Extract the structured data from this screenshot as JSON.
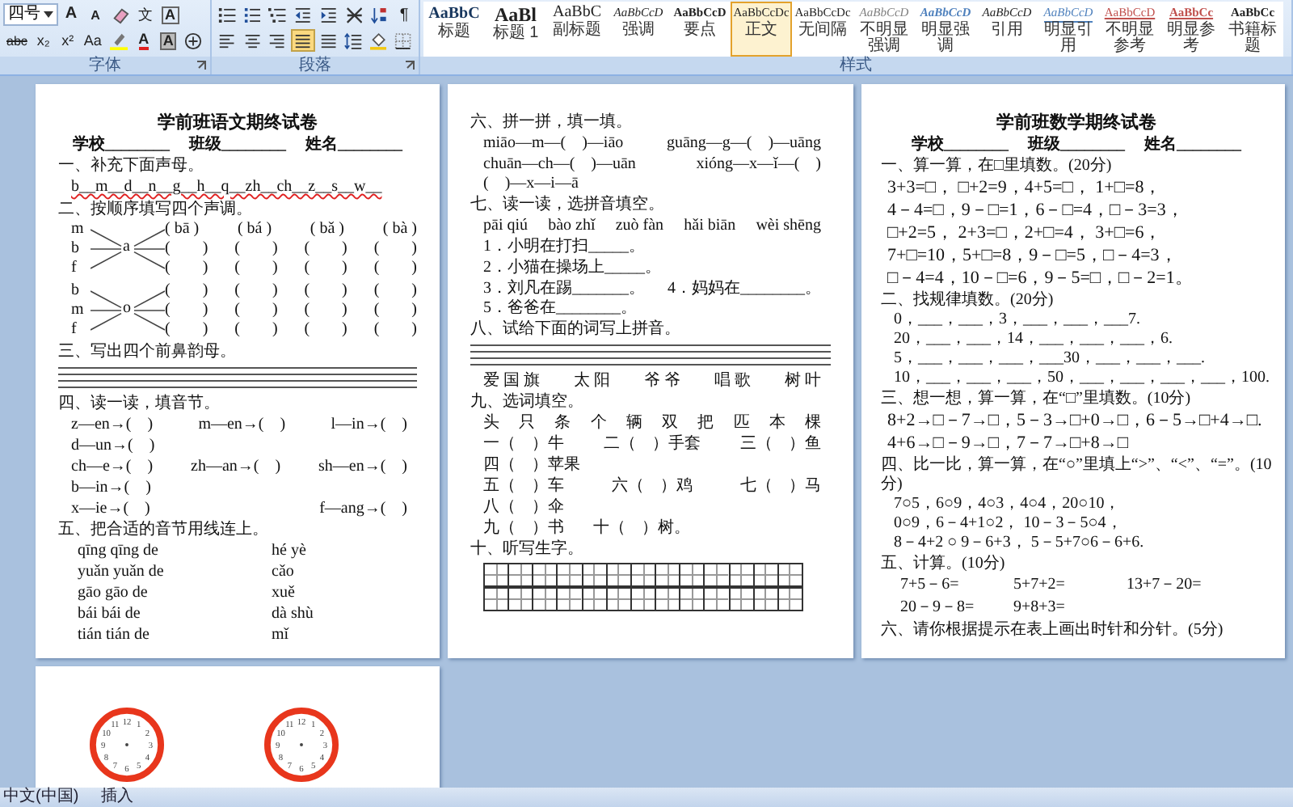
{
  "ribbon": {
    "font_group": {
      "label": "字体",
      "size_field": "四号",
      "row1": [
        {
          "kind": "grow",
          "label": "A"
        },
        {
          "kind": "shrink",
          "label": "A"
        },
        {
          "kind": "clear"
        },
        {
          "kind": "phonetic",
          "label": "文"
        },
        {
          "kind": "boxed",
          "label": "A"
        }
      ],
      "row2": [
        {
          "kind": "strike",
          "label": "abc"
        },
        {
          "kind": "sub",
          "label": "x₂"
        },
        {
          "kind": "sup",
          "label": "x²"
        },
        {
          "kind": "case",
          "label": "Aa"
        },
        {
          "kind": "highlight"
        },
        {
          "kind": "color",
          "label": "A"
        },
        {
          "kind": "shade",
          "label": "A"
        },
        {
          "kind": "enclose"
        }
      ]
    },
    "para_group": {
      "label": "段落",
      "row1": [
        {
          "kind": "bullets"
        },
        {
          "kind": "numbering"
        },
        {
          "kind": "multilevel"
        },
        {
          "kind": "outdent"
        },
        {
          "kind": "indent"
        },
        {
          "kind": "asian_layout"
        },
        {
          "kind": "sort"
        },
        {
          "kind": "pilcrow",
          "label": "¶"
        }
      ],
      "row2": [
        {
          "kind": "align_left",
          "selected": false
        },
        {
          "kind": "align_center",
          "selected": false
        },
        {
          "kind": "align_right",
          "selected": false
        },
        {
          "kind": "justify",
          "selected": true
        },
        {
          "kind": "distributed",
          "selected": false
        },
        {
          "kind": "line_spacing",
          "selected": false
        },
        {
          "kind": "shading",
          "selected": false
        },
        {
          "kind": "borders",
          "selected": false
        }
      ]
    },
    "styles_group": {
      "label": "样式",
      "styles": [
        {
          "kind": "heading",
          "sample": "AaBbC",
          "name": "标题",
          "selected": false
        },
        {
          "kind": "title",
          "sample": "AaBl",
          "name": "标题 1",
          "selected": false
        },
        {
          "kind": "subtitle",
          "sample": "AaBbC",
          "name": "副标题",
          "selected": false
        },
        {
          "kind": "emphasis",
          "sample": "AaBbCcD",
          "name": "强调",
          "selected": false
        },
        {
          "kind": "strong",
          "sample": "AaBbCcD",
          "name": "要点",
          "selected": false
        },
        {
          "kind": "normal",
          "sample": "AaBbCcDc",
          "name": "正文",
          "selected": true
        },
        {
          "kind": "nospacing",
          "sample": "AaBbCcDc",
          "name": "无间隔",
          "selected": false
        },
        {
          "kind": "subtle_emphasis",
          "sample": "AaBbCcD",
          "name": "不明显强调",
          "selected": false
        },
        {
          "kind": "intense_emphasis",
          "sample": "AaBbCcD",
          "name": "明显强调",
          "selected": false
        },
        {
          "kind": "quote",
          "sample": "AaBbCcD",
          "name": "引用",
          "selected": false
        },
        {
          "kind": "intense_quote",
          "sample": "AaBbCcD",
          "name": "明显引用",
          "selected": false
        },
        {
          "kind": "subtle_reference",
          "sample": "AaBbCcD",
          "name": "不明显参考",
          "selected": false
        },
        {
          "kind": "intense_reference",
          "sample": "AaBbCc",
          "name": "明显参考",
          "selected": false
        },
        {
          "kind": "book_title",
          "sample": "AaBbCc",
          "name": "书籍标题",
          "selected": false
        }
      ]
    }
  },
  "pages": [
    {
      "blocks": [
        {
          "kind": "title",
          "text": "学前班语文期终试卷"
        },
        {
          "kind": "fields",
          "items": [
            "学校________",
            "班级________",
            "姓名________"
          ]
        },
        {
          "kind": "heading",
          "text": "一、补充下面声母。"
        },
        {
          "kind": "spelling",
          "text": "b__m__d__n__g__h__q__zh__ch__z__s__w__"
        },
        {
          "kind": "heading",
          "text": "二、按顺序填写四个声调。"
        },
        {
          "kind": "fan",
          "letters": [
            "m",
            "b",
            "f"
          ],
          "vowel": "a",
          "rows": [
            [
              "( bā )",
              "( bá )",
              "( bǎ )",
              "( bà )"
            ],
            [
              "(　　)",
              "(　　)",
              "(　　)",
              "(　　)"
            ],
            [
              "(　　)",
              "(　　)",
              "(　　)",
              "(　　)"
            ]
          ]
        },
        {
          "kind": "fan",
          "letters": [
            "b",
            "m",
            "f"
          ],
          "vowel": "o",
          "rows": [
            [
              "(　　)",
              "(　　)",
              "(　　)",
              "(　　)"
            ],
            [
              "(　　)",
              "(　　)",
              "(　　)",
              "(　　)"
            ],
            [
              "(　　)",
              "(　　)",
              "(　　)",
              "(　　)"
            ]
          ]
        },
        {
          "kind": "heading",
          "text": "三、写出四个前鼻韵母。"
        },
        {
          "kind": "rules"
        },
        {
          "kind": "heading",
          "text": "四、读一读，填音节。"
        },
        {
          "kind": "cols",
          "cells": [
            "z—en→(　)",
            "m—en→(　)",
            "l—in→(　)",
            "d—un→(　)"
          ]
        },
        {
          "kind": "cols",
          "cells": [
            "ch—e→(　)",
            "zh—an→(　)",
            "sh—en→(　)",
            "b—in→(　)"
          ]
        },
        {
          "kind": "cols",
          "cells": [
            "x—ie→(　)",
            "f—ang→(　)"
          ]
        },
        {
          "kind": "heading",
          "text": "五、把合适的音节用线连上。"
        },
        {
          "kind": "pair",
          "cells": [
            "qīng qīng de",
            "hé yè"
          ]
        },
        {
          "kind": "pair",
          "cells": [
            "yuǎn yuǎn de",
            "cǎo"
          ]
        },
        {
          "kind": "pair",
          "cells": [
            "gāo gāo de",
            "xuě"
          ]
        },
        {
          "kind": "pair",
          "cells": [
            "bái bái de",
            "dà shù"
          ]
        },
        {
          "kind": "pair",
          "cells": [
            "tián tián de",
            "mǐ"
          ]
        }
      ]
    },
    {
      "blocks": [
        {
          "kind": "heading",
          "text": "六、拼一拼，填一填。"
        },
        {
          "kind": "cols",
          "cells": [
            "miāo—m—(　)—iāo",
            "guāng—g—(　)—uāng"
          ]
        },
        {
          "kind": "cols",
          "cells": [
            "chuān—ch—(　)—uān",
            "xióng—x—ǐ—(　)"
          ]
        },
        {
          "kind": "line",
          "text": "(　)—x—i—ā"
        },
        {
          "kind": "heading",
          "text": "七、读一读，选拼音填空。"
        },
        {
          "kind": "cols",
          "cells": [
            "pāi qiú",
            "bào zhǐ",
            "zuò fàn",
            "hǎi biān",
            "wèi shēng"
          ]
        },
        {
          "kind": "cols",
          "cells": [
            "1．小明在打扫_____。",
            "2．小猫在操场上_____。"
          ]
        },
        {
          "kind": "cols",
          "cells": [
            "3．刘凡在踢_______。",
            "4．妈妈在________。"
          ]
        },
        {
          "kind": "line",
          "text": "5．爸爸在________。"
        },
        {
          "kind": "heading",
          "text": "八、试给下面的词写上拼音。"
        },
        {
          "kind": "rules"
        },
        {
          "kind": "cols",
          "cells": [
            "爱 国 旗",
            "太 阳",
            "爷 爷",
            "唱 歌",
            "树 叶"
          ]
        },
        {
          "kind": "heading",
          "text": "九、选词填空。"
        },
        {
          "kind": "cols",
          "cells": [
            "头",
            "只",
            "条",
            "个",
            "辆",
            "双",
            "把",
            "匹",
            "本",
            "棵"
          ]
        },
        {
          "kind": "cols",
          "cells": [
            "一（　）牛",
            "二（　）手套",
            "三（　）鱼",
            "四（　）苹果"
          ]
        },
        {
          "kind": "cols",
          "cells": [
            "五（　）车",
            "六（　）鸡",
            "七（　）马",
            "八（　）伞"
          ]
        },
        {
          "kind": "inline",
          "cells": [
            "九（　）书",
            "十（　）树。"
          ]
        },
        {
          "kind": "heading",
          "text": "十、听写生字。"
        },
        {
          "kind": "grid"
        }
      ]
    },
    {
      "blocks": [
        {
          "kind": "title",
          "text": "学前班数学期终试卷"
        },
        {
          "kind": "fields",
          "items": [
            "学校________",
            "班级________",
            "姓名________"
          ]
        },
        {
          "kind": "heading",
          "text": "一、算一算，在□里填数。(20分)"
        },
        {
          "kind": "eq",
          "text": "3+3=□，  □+2=9，4+5=□，  1+□=8，"
        },
        {
          "kind": "eq",
          "text": "4－4=□，9－□=1，6－□=4，□－3=3，"
        },
        {
          "kind": "eq",
          "text": "□+2=5，  2+3=□，2+□=4，  3+□=6，"
        },
        {
          "kind": "eq",
          "text": "7+□=10，5+□=8，9－□=5，□－4=3，"
        },
        {
          "kind": "eq",
          "text": "□－4=4，10－□=6，9－5=□，□－2=1。"
        },
        {
          "kind": "heading",
          "text": "二、找规律填数。(20分)"
        },
        {
          "kind": "line",
          "text": "0，___，___，3，___，___，___7."
        },
        {
          "kind": "line",
          "text": "20，___，___，14，___，___，___，6."
        },
        {
          "kind": "line",
          "text": "5，___，___，___，___30，___，___，___."
        },
        {
          "kind": "line",
          "text": "10，___，___，___，50，___，___，___，___，100."
        },
        {
          "kind": "heading",
          "text": "三、想一想，算一算，在“□”里填数。(10分)"
        },
        {
          "kind": "eq",
          "text": "8+2→□－7→□，5－3→□+0→□，6－5→□+4→□."
        },
        {
          "kind": "eq",
          "text": "4+6→□－9→□，7－7→□+8→□"
        },
        {
          "kind": "heading",
          "text": "四、比一比，算一算，在“○”里填上“>”、“<”、“=”。(10分)"
        },
        {
          "kind": "line",
          "text": "7○5，6○9，4○3，4○4，20○10，"
        },
        {
          "kind": "line",
          "text": "0○9，6－4+1○2，  10－3－5○4，"
        },
        {
          "kind": "line",
          "text": "8－4+2 ○ 9－6+3，   5－5+7○6－6+6."
        },
        {
          "kind": "heading",
          "text": "五、计算。(10分)"
        },
        {
          "kind": "cols3",
          "cells": [
            "7+5－6=",
            "5+7+2=",
            "13+7－20="
          ]
        },
        {
          "kind": "cols3",
          "cells": [
            "20－9－8=",
            "9+8+3="
          ]
        },
        {
          "kind": "heading",
          "text": "六、请你根据提示在表上画出时针和分针。(5分)"
        }
      ]
    }
  ],
  "last_page": {
    "clocks": [
      {
        "numbers": [
          "11",
          "12",
          "1",
          "10",
          "2",
          "9",
          "3",
          "8",
          "4",
          "7",
          "5",
          "6"
        ]
      },
      {
        "numbers": [
          "11",
          "12",
          "1",
          "10",
          "2",
          "9",
          "3",
          "8",
          "4",
          "7",
          "5",
          "6"
        ]
      }
    ]
  },
  "status_bar": {
    "language": "中文(中国)",
    "mode": "插入"
  }
}
